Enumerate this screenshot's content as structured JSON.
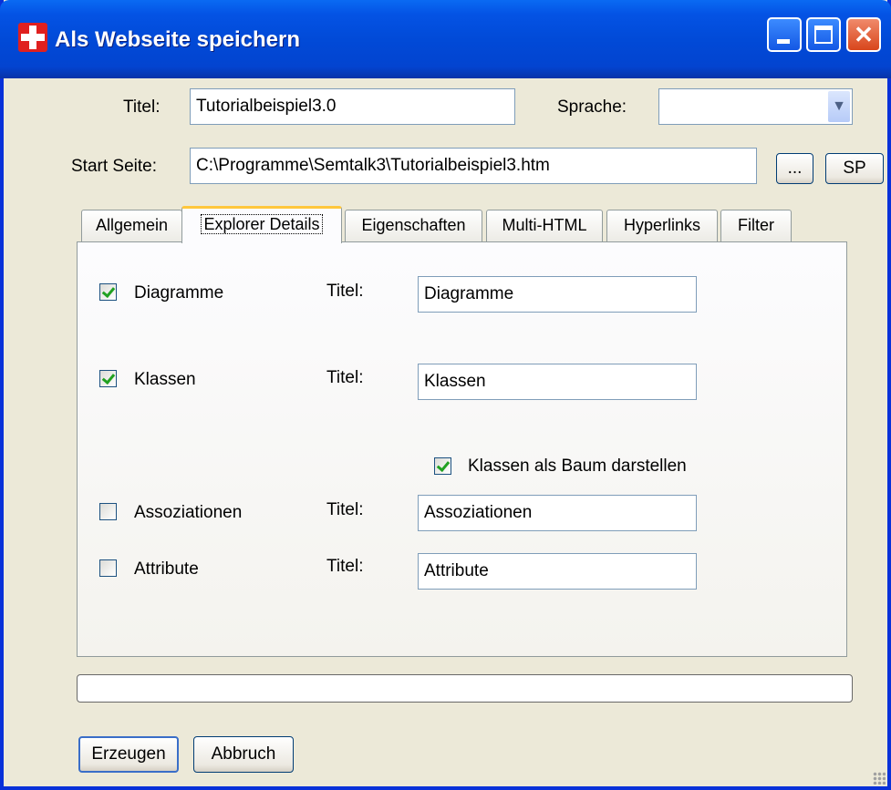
{
  "window": {
    "title": "Als Webseite speichern",
    "close_glyph": "✕"
  },
  "form": {
    "title_label": "Titel:",
    "title_value": "Tutorialbeispiel3.0",
    "language_label": "Sprache:",
    "language_value": "",
    "start_label": "Start Seite:",
    "start_value": "C:\\Programme\\Semtalk3\\Tutorialbeispiel3.htm",
    "browse_label": "...",
    "sp_label": "SP"
  },
  "tabs": [
    {
      "label": "Allgemein",
      "active": false
    },
    {
      "label": "Explorer Details",
      "active": true
    },
    {
      "label": "Eigenschaften",
      "active": false
    },
    {
      "label": "Multi-HTML",
      "active": false
    },
    {
      "label": "Hyperlinks",
      "active": false
    },
    {
      "label": "Filter",
      "active": false
    }
  ],
  "details": {
    "diagramme": {
      "label": "Diagramme",
      "checked": true,
      "titel_label": "Titel:",
      "value": "Diagramme"
    },
    "klassen": {
      "label": "Klassen",
      "checked": true,
      "titel_label": "Titel:",
      "value": "Klassen"
    },
    "baum": {
      "label": "Klassen als Baum darstellen",
      "checked": true
    },
    "assoziationen": {
      "label": "Assoziationen",
      "checked": false,
      "titel_label": "Titel:",
      "value": "Assoziationen"
    },
    "attribute": {
      "label": "Attribute",
      "checked": false,
      "titel_label": "Titel:",
      "value": "Attribute"
    }
  },
  "progress": {
    "value": 0
  },
  "buttons": {
    "create": "Erzeugen",
    "cancel": "Abbruch"
  },
  "colors": {
    "titlebar": "#0449d6",
    "frame": "#0831d9",
    "dialog_bg": "#ece9d8",
    "tab_highlight": "#ffc73c",
    "check_mark": "#21a121"
  },
  "icons": {
    "app": "red-cross-icon",
    "minimize": "minimize-icon",
    "maximize": "maximize-icon",
    "close": "close-icon",
    "dropdown": "chevron-down-icon"
  }
}
